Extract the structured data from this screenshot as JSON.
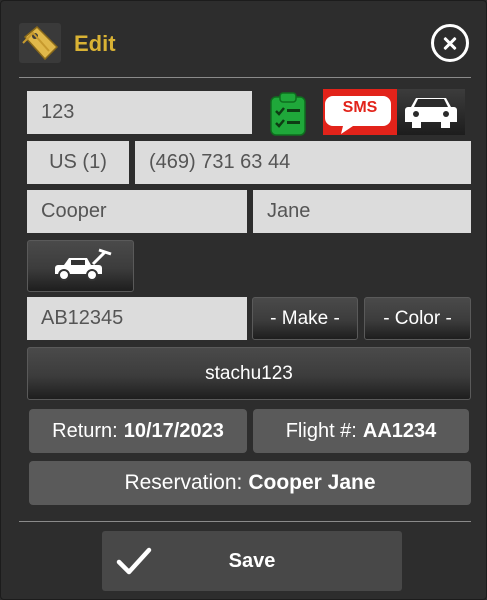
{
  "header": {
    "title": "Edit",
    "title_color": "#d9b234",
    "icon": "tag-icon",
    "close_icon": "close-icon"
  },
  "form": {
    "code": "123",
    "country_code": "US (1)",
    "phone": "(469) 731 63 44",
    "last_name": "Cooper",
    "first_name": "Jane",
    "plate": "AB12345",
    "make_label": "- Make -",
    "color_label": "- Color -",
    "username": "stachu123"
  },
  "actions": {
    "checklist_icon": "clipboard-checklist-icon",
    "sms_label": "SMS",
    "sms_color": "#e2231a",
    "car_icon": "car-icon",
    "vehicle_icon": "car-with-open-hood-icon"
  },
  "info": {
    "return_label": "Return:",
    "return_value": "10/17/2023",
    "flight_label": "Flight #:",
    "flight_value": "AA1234",
    "reservation_label": "Reservation:",
    "reservation_value": "Cooper Jane"
  },
  "footer": {
    "save_label": "Save",
    "check_icon": "checkmark-icon"
  }
}
